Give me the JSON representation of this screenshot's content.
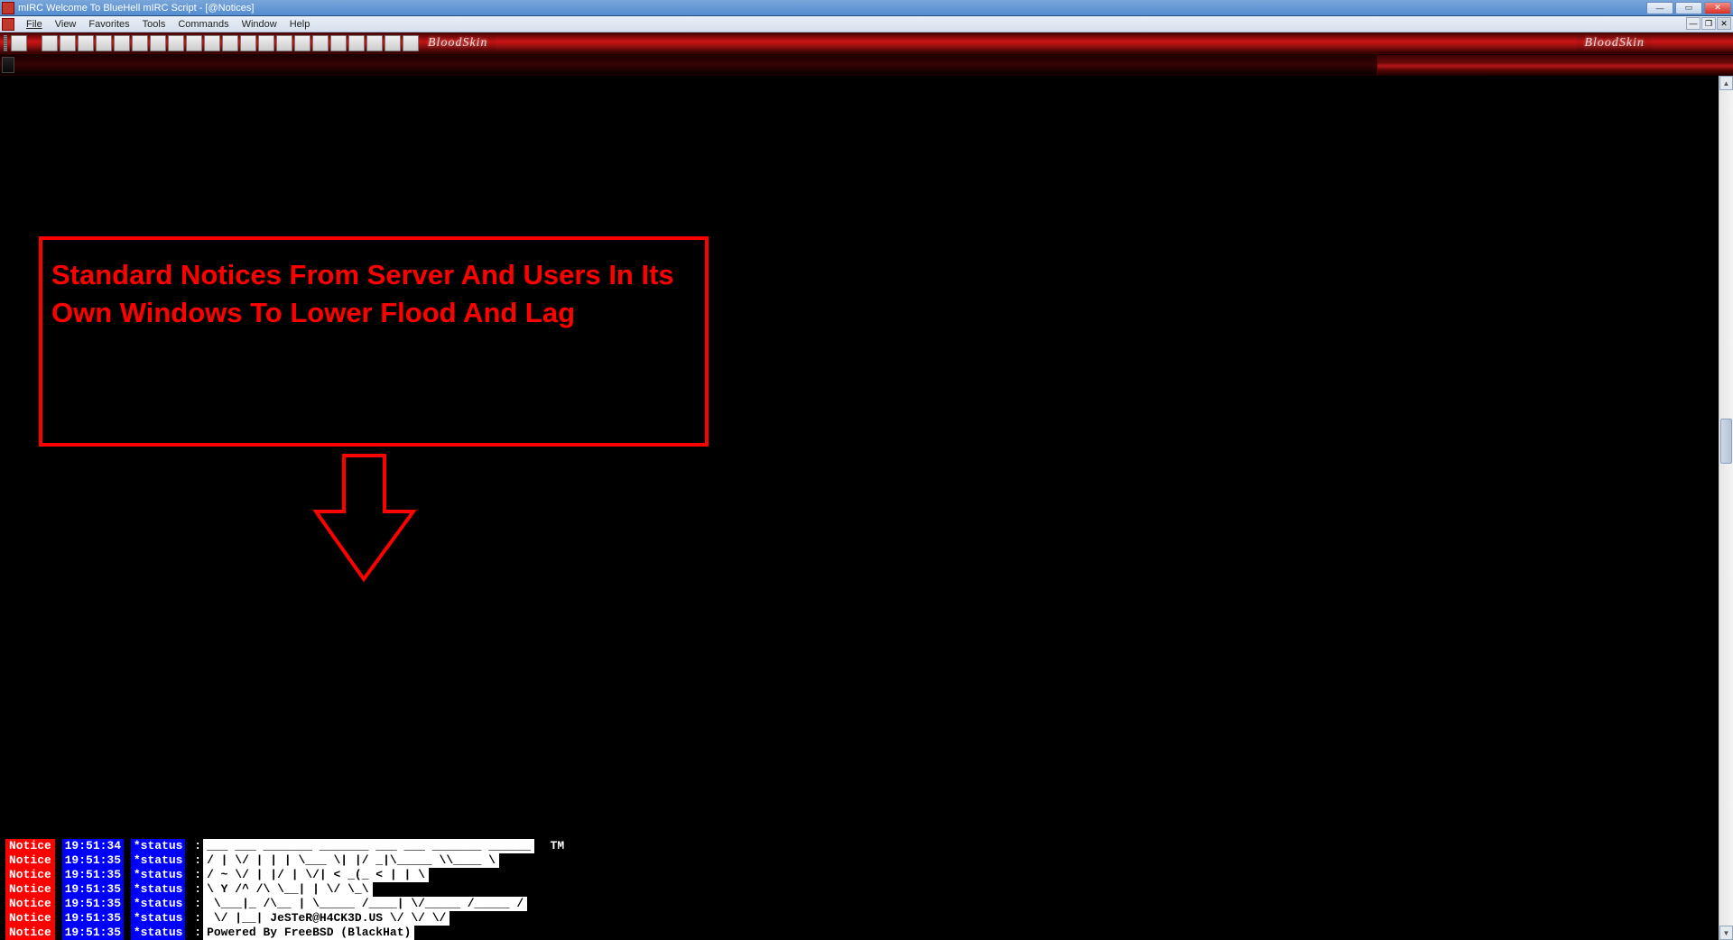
{
  "window": {
    "title": "mIRC Welcome To BlueHell mIRC Script - [@Notices]"
  },
  "menu": {
    "items": [
      "File",
      "View",
      "Favorites",
      "Tools",
      "Commands",
      "Window",
      "Help"
    ]
  },
  "toolbar": {
    "brand": "BloodSkin"
  },
  "annotation": {
    "text": "Standard Notices From Server And Users In Its Own Windows To Lower Flood And Lag"
  },
  "notices": [
    {
      "label": "Notice",
      "time": "19:51:34",
      "source": "*status",
      "body": "___ ___ _______ _______ ___ ___ _______ ______",
      "tm": "  TM"
    },
    {
      "label": "Notice",
      "time": "19:51:35",
      "source": "*status",
      "body": "/ | \\/ | | | \\___ \\| |/ _|\\_____ \\\\____ \\"
    },
    {
      "label": "Notice",
      "time": "19:51:35",
      "source": "*status",
      "body": "/ ~ \\/ | |/ | \\/| < _(_ < | | \\"
    },
    {
      "label": "Notice",
      "time": "19:51:35",
      "source": "*status",
      "body": "\\ Y /^ /\\ \\__| | \\/ \\_\\"
    },
    {
      "label": "Notice",
      "time": "19:51:35",
      "source": "*status",
      "body": " \\___|_ /\\__ | \\_____ /____| \\/_____ /_____ /"
    },
    {
      "label": "Notice",
      "time": "19:51:35",
      "source": "*status",
      "body": " \\/ |__| JeSTeR@H4CK3D.US \\/ \\/ \\/"
    },
    {
      "label": "Notice",
      "time": "19:51:35",
      "source": "*status",
      "body": "Powered By FreeBSD (BlackHat)"
    }
  ]
}
